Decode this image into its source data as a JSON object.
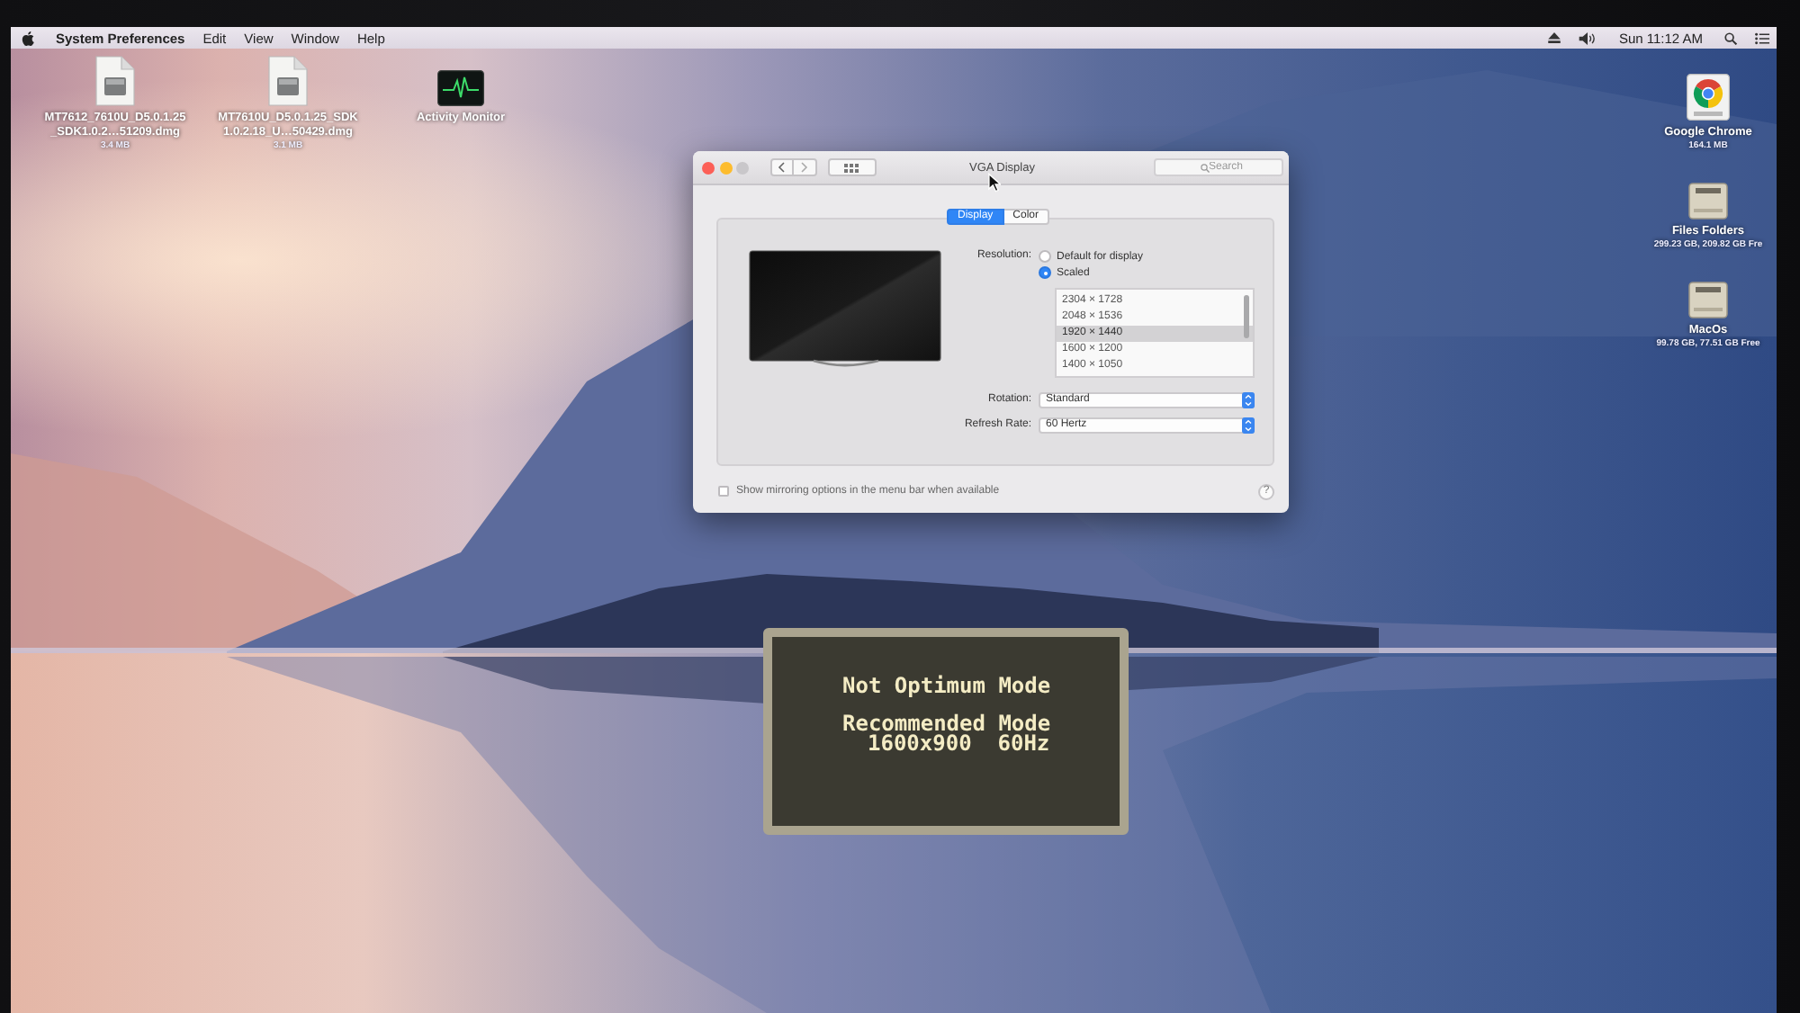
{
  "menu_bar": {
    "app_name": "System Preferences",
    "menus": [
      "Edit",
      "View",
      "Window",
      "Help"
    ],
    "clock": "Sun 11:12 AM"
  },
  "desktop": {
    "left": [
      {
        "kind": "disk_image",
        "label": "MT7612_7610U_D5.0.1.25_SDK1.0.2…51209.dmg",
        "info": "3.4 MB"
      },
      {
        "kind": "disk_image",
        "label": "MT7610U_D5.0.1.25_SDK1.0.2.18_U…50429.dmg",
        "info": "3.1 MB"
      },
      {
        "kind": "activity_app",
        "label": "Activity Monitor"
      }
    ],
    "right": [
      {
        "kind": "browser_app",
        "label": "Google Chrome",
        "info": "164.1 MB"
      },
      {
        "kind": "drive",
        "label": "Files Folders",
        "info": "299.23 GB, 209.82 GB Fre"
      },
      {
        "kind": "drive",
        "label": "MacOs",
        "info": "99.78 GB, 77.51 GB Free"
      }
    ]
  },
  "window": {
    "title": "VGA Display",
    "search": {
      "placeholder": "Search"
    },
    "tabs": [
      {
        "label": "Display",
        "selected": true
      },
      {
        "label": "Color",
        "selected": false
      }
    ],
    "resolution": {
      "label": "Resolution:",
      "options": [
        {
          "label": "Default for display",
          "selected": false
        },
        {
          "label": "Scaled",
          "selected": true
        }
      ],
      "modes": [
        {
          "label": "2304 × 1728",
          "selected": false
        },
        {
          "label": "2048 × 1536",
          "selected": false
        },
        {
          "label": "1920 × 1440",
          "selected": true
        },
        {
          "label": "1600 × 1200",
          "selected": false
        },
        {
          "label": "1400 × 1050",
          "selected": false
        }
      ]
    },
    "popups": [
      {
        "label": "Rotation:",
        "value": "Standard"
      },
      {
        "label": "Refresh Rate:",
        "value": "60 Hertz"
      }
    ],
    "mirroring": {
      "label": "Show mirroring options in the menu bar when available",
      "checked": false
    },
    "help": "?"
  },
  "osd": {
    "title": "Not Optimum Mode",
    "recommended_label": "Recommended Mode",
    "recommended_value": "1600x900  60Hz"
  }
}
